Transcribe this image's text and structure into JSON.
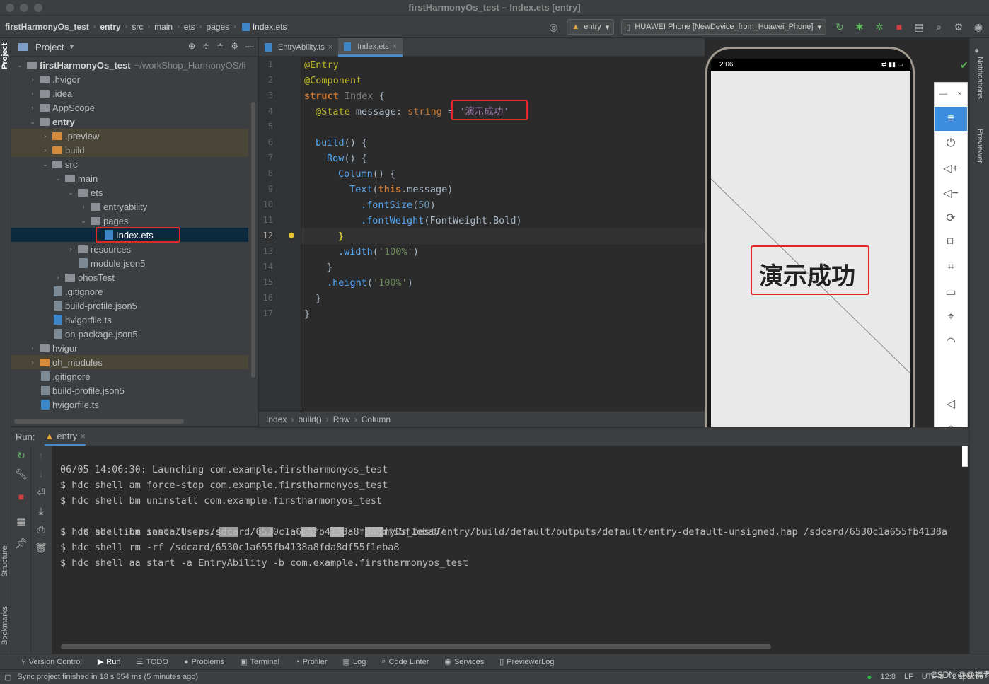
{
  "window": {
    "title": "firstHarmonyOs_test – Index.ets [entry]"
  },
  "navbar": {
    "breadcrumbs": [
      "firstHarmonyOs_test",
      "entry",
      "src",
      "main",
      "ets",
      "pages",
      "Index.ets"
    ],
    "module_combo": "entry",
    "device_combo": "HUAWEI Phone [NewDevice_from_Huawei_Phone]"
  },
  "left_stripe": {
    "project": "Project",
    "structure": "Structure",
    "bookmarks": "Bookmarks"
  },
  "project": {
    "header": "Project",
    "root_name": "firstHarmonyOs_test",
    "root_path": "~/workShop_HarmonyOS/fi",
    "items": [
      {
        "label": ".hvigor"
      },
      {
        "label": ".idea"
      },
      {
        "label": "AppScope"
      },
      {
        "label": "entry"
      },
      {
        "label": ".preview"
      },
      {
        "label": "build"
      },
      {
        "label": "src"
      },
      {
        "label": "main"
      },
      {
        "label": "ets"
      },
      {
        "label": "entryability"
      },
      {
        "label": "pages"
      },
      {
        "label": "Index.ets"
      },
      {
        "label": "resources"
      },
      {
        "label": "module.json5"
      },
      {
        "label": "ohosTest"
      },
      {
        "label": ".gitignore"
      },
      {
        "label": "build-profile.json5"
      },
      {
        "label": "hvigorfile.ts"
      },
      {
        "label": "oh-package.json5"
      },
      {
        "label": "hvigor"
      },
      {
        "label": "oh_modules"
      },
      {
        "label": ".gitignore"
      },
      {
        "label": "build-profile.json5"
      },
      {
        "label": "hvigorfile.ts"
      }
    ]
  },
  "editor": {
    "tabs": [
      {
        "label": "EntryAbility.ts"
      },
      {
        "label": "Index.ets"
      }
    ],
    "line_numbers": [
      "1",
      "2",
      "3",
      "4",
      "5",
      "6",
      "7",
      "8",
      "9",
      "10",
      "11",
      "12",
      "13",
      "14",
      "15",
      "16",
      "17"
    ],
    "current_line": "12",
    "code": {
      "l1": "@Entry",
      "l2": "@Component",
      "l3_kw": "struct",
      "l3_name": "Index",
      "l3_brace": " {",
      "l4_dec": "@State",
      "l4_prop": "message",
      "l4_colon": ": ",
      "l4_type": "string",
      "l4_eq": " = ",
      "l4_val": "'演示成功'",
      "l6_fn": "build",
      "l6_rest": "() {",
      "l7_fn": "Row",
      "l7_rest": "() {",
      "l8_fn": "Column",
      "l8_rest": "() {",
      "l9_fn": "Text",
      "l9_open": "(",
      "l9_this": "this",
      "l9_prop": ".message",
      "l9_close": ")",
      "l10_fn": ".fontSize",
      "l10_open": "(",
      "l10_num": "50",
      "l10_close": ")",
      "l11_fn": ".fontWeight",
      "l11_arg": "(FontWeight.Bold)",
      "l12": "}",
      "l13_fn": ".width",
      "l13_open": "(",
      "l13_str": "'100%'",
      "l13_close": ")",
      "l14": "}",
      "l15_fn": ".height",
      "l15_open": "(",
      "l15_str": "'100%'",
      "l15_close": ")",
      "l16": "}",
      "l17": "}"
    },
    "breadcrumbs": [
      "Index",
      "build()",
      "Row",
      "Column"
    ]
  },
  "previewer": {
    "status_time": "2:06",
    "display_text": "演示成功",
    "right_stripe": {
      "notifications": "Notifications",
      "previewer": "Previewer"
    }
  },
  "run": {
    "label": "Run:",
    "tab": "entry",
    "console_lines": [
      "06/05 14:06:30: Launching com.example.firstharmonyos_test",
      "$ hdc shell am force-stop com.example.firstharmonyos_test",
      "$ hdc shell bm uninstall com.example.firstharmonyos_test",
      "$ hdc file send /Users.",
      "nyOs_test/entry/build/default/outputs/default/entry-default-unsigned.hap /sdcard/6530c1a655fb4138a",
      "$ hdc shell bm install -p /sdcard/6530c1a655fb4138a8fda8df55f1eba8/",
      "$ hdc shell rm -rf /sdcard/6530c1a655fb4138a8fda8df55f1eba8",
      "$ hdc shell aa start -a EntryAbility -b com.example.firstharmonyos_test"
    ]
  },
  "tool_windows": [
    {
      "label": "Version Control",
      "icon": "branch-icon"
    },
    {
      "label": "Run",
      "icon": "play-icon"
    },
    {
      "label": "TODO",
      "icon": "list-icon"
    },
    {
      "label": "Problems",
      "icon": "info-icon"
    },
    {
      "label": "Terminal",
      "icon": "terminal-icon"
    },
    {
      "label": "Profiler",
      "icon": "gauge-icon"
    },
    {
      "label": "Log",
      "icon": "log-icon"
    },
    {
      "label": "Code Linter",
      "icon": "magnifier-icon"
    },
    {
      "label": "Services",
      "icon": "services-icon"
    },
    {
      "label": "PreviewerLog",
      "icon": "doc-icon"
    }
  ],
  "statusbar": {
    "message": "Sync project finished in 18 s 654 ms (5 minutes ago)",
    "position": "12:8",
    "line_sep": "LF",
    "encoding": "UTF-8",
    "indent": "2 spaces",
    "watermark": "CSDN @@福老"
  },
  "colors": {
    "accent": "#4a88c7",
    "highlight_box": "#e3262a",
    "run_green": "#499c54"
  }
}
